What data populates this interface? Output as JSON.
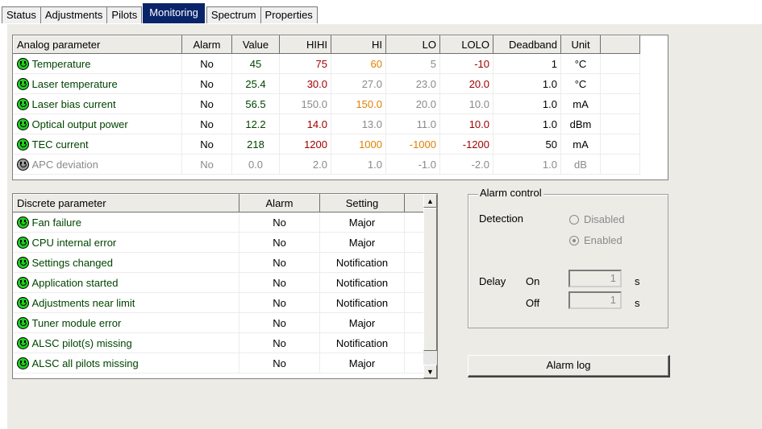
{
  "tabs": [
    "Status",
    "Adjustments",
    "Pilots",
    "Monitoring",
    "Spectrum",
    "Properties"
  ],
  "active_tab": "Monitoring",
  "colors": {
    "hihi": "#a00000",
    "hi": "#e08000",
    "active_tab_bg": "#0a246a",
    "status_ok": "#22cc22",
    "status_na": "#9a9a9a"
  },
  "analog": {
    "headers": [
      "Analog parameter",
      "Alarm",
      "Value",
      "HIHI",
      "HI",
      "LO",
      "LOLO",
      "Deadband",
      "Unit"
    ],
    "rows": [
      {
        "name": "Temperature",
        "alarm": "No",
        "value": "45",
        "hihi": "75",
        "hi": "60",
        "lo": "5",
        "lolo": "-10",
        "deadband": "1",
        "unit": "°C",
        "status": "ok",
        "hihi_style": "red",
        "hi_style": "orange",
        "lo_style": "gray",
        "lolo_style": "red"
      },
      {
        "name": "Laser temperature",
        "alarm": "No",
        "value": "25.4",
        "hihi": "30.0",
        "hi": "27.0",
        "lo": "23.0",
        "lolo": "20.0",
        "deadband": "1.0",
        "unit": "°C",
        "status": "ok",
        "hihi_style": "red",
        "hi_style": "gray",
        "lo_style": "gray",
        "lolo_style": "red"
      },
      {
        "name": "Laser bias current",
        "alarm": "No",
        "value": "56.5",
        "hihi": "150.0",
        "hi": "150.0",
        "lo": "20.0",
        "lolo": "10.0",
        "deadband": "1.0",
        "unit": "mA",
        "status": "ok",
        "hihi_style": "gray",
        "hi_style": "orange",
        "lo_style": "gray",
        "lolo_style": "gray"
      },
      {
        "name": "Optical output power",
        "alarm": "No",
        "value": "12.2",
        "hihi": "14.0",
        "hi": "13.0",
        "lo": "11.0",
        "lolo": "10.0",
        "deadband": "1.0",
        "unit": "dBm",
        "status": "ok",
        "hihi_style": "red",
        "hi_style": "gray",
        "lo_style": "gray",
        "lolo_style": "red"
      },
      {
        "name": "TEC current",
        "alarm": "No",
        "value": "218",
        "hihi": "1200",
        "hi": "1000",
        "lo": "-1000",
        "lolo": "-1200",
        "deadband": "50",
        "unit": "mA",
        "status": "ok",
        "hihi_style": "red",
        "hi_style": "orange",
        "lo_style": "orange",
        "lolo_style": "red"
      },
      {
        "name": "APC deviation",
        "alarm": "No",
        "value": "0.0",
        "hihi": "2.0",
        "hi": "1.0",
        "lo": "-1.0",
        "lolo": "-2.0",
        "deadband": "1.0",
        "unit": "dB",
        "status": "disabled",
        "hihi_style": "gray",
        "hi_style": "gray",
        "lo_style": "gray",
        "lolo_style": "gray"
      }
    ]
  },
  "discrete": {
    "headers": [
      "Discrete parameter",
      "Alarm",
      "Setting"
    ],
    "rows": [
      {
        "name": "Fan failure",
        "alarm": "No",
        "setting": "Major"
      },
      {
        "name": "CPU internal error",
        "alarm": "No",
        "setting": "Major"
      },
      {
        "name": "Settings changed",
        "alarm": "No",
        "setting": "Notification"
      },
      {
        "name": "Application started",
        "alarm": "No",
        "setting": "Notification"
      },
      {
        "name": "Adjustments near limit",
        "alarm": "No",
        "setting": "Notification"
      },
      {
        "name": "Tuner module error",
        "alarm": "No",
        "setting": "Major"
      },
      {
        "name": "ALSC pilot(s) missing",
        "alarm": "No",
        "setting": "Notification"
      },
      {
        "name": "ALSC all pilots missing",
        "alarm": "No",
        "setting": "Major"
      }
    ]
  },
  "alarm_control": {
    "title": "Alarm control",
    "detection_label": "Detection",
    "options": [
      "Disabled",
      "Enabled"
    ],
    "selected": "Enabled",
    "delay_label": "Delay",
    "on_label": "On",
    "off_label": "Off",
    "on_value": "1",
    "off_value": "1",
    "unit": "s"
  },
  "alarm_log_button": "Alarm log"
}
